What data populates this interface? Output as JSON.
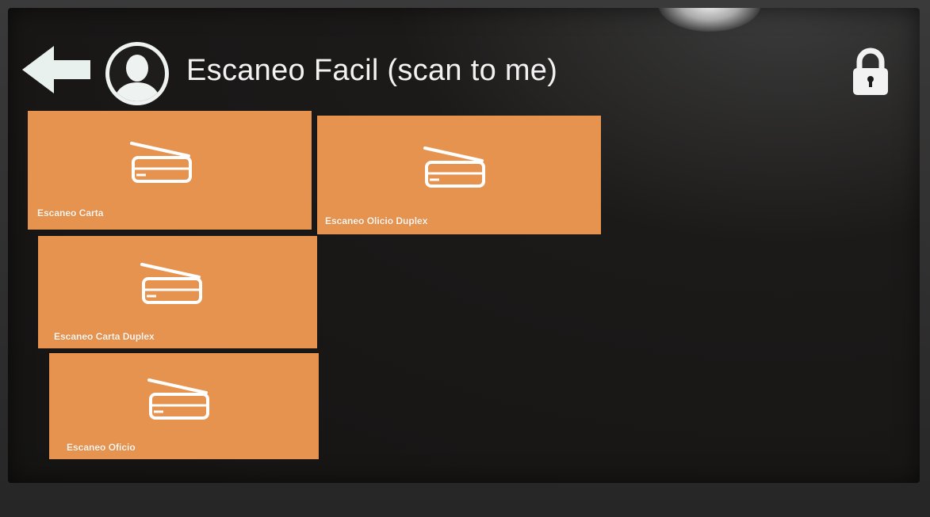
{
  "header": {
    "title": "Escaneo Facil (scan to me)"
  },
  "icons": {
    "back": "arrow-left-icon",
    "user": "user-avatar-icon",
    "lock": "lock-icon",
    "tile": "scanner-icon"
  },
  "colors": {
    "tile": "#e5934f",
    "background": "#1c1a19",
    "text": "#f2f2f2"
  },
  "tiles": [
    {
      "label": "Escaneo Carta"
    },
    {
      "label": "Escaneo Olicio Duplex"
    },
    {
      "label": "Escaneo Carta Duplex"
    },
    {
      "label": "Escaneo Oficio"
    }
  ]
}
